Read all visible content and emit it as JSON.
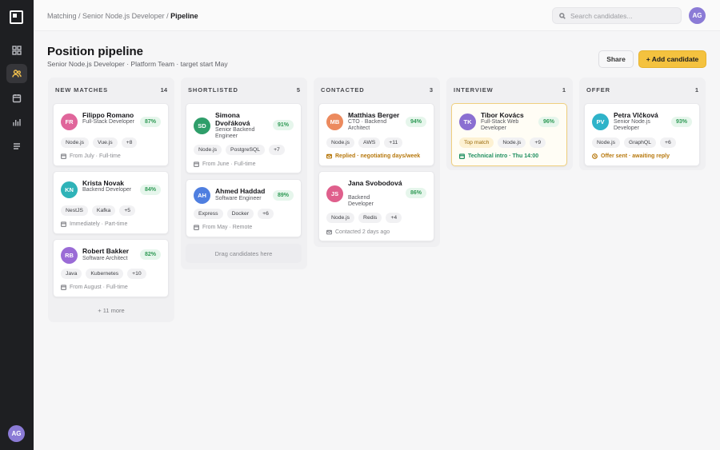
{
  "breadcrumb": {
    "part1": "Matching",
    "sep": " / ",
    "part2": "Senior Node.js Developer",
    "current": "Pipeline"
  },
  "search": {
    "placeholder": "Search candidates..."
  },
  "user": {
    "initials": "AG"
  },
  "page": {
    "title": "Position pipeline",
    "subtitle": "Senior Node.js Developer · Platform Team · target start May",
    "share_label": "Share",
    "add_label": "+ Add candidate"
  },
  "columns": [
    {
      "title": "NEW MATCHES",
      "count": "14",
      "more": "+ 11 more",
      "cards": [
        {
          "initials": "FR",
          "color": "#e0669b",
          "name": "Filippo Romano",
          "role": "Full-Stack Developer",
          "match": "87%",
          "tags": [
            "Node.js",
            "Vue.js",
            "+8"
          ],
          "foot": "From July · Full-time"
        },
        {
          "initials": "KN",
          "color": "#2fb3b8",
          "name": "Krista Novak",
          "role": "Backend Developer",
          "match": "84%",
          "tags": [
            "NestJS",
            "Kafka",
            "+5"
          ],
          "foot": "Immediately · Part-time"
        },
        {
          "initials": "RB",
          "color": "#9a6bd6",
          "name": "Robert Bakker",
          "role": "Software Architect",
          "match": "82%",
          "tags": [
            "Java",
            "Kubernetes",
            "+10"
          ],
          "foot": "From August · Full-time"
        }
      ]
    },
    {
      "title": "SHORTLISTED",
      "count": "5",
      "drop": "Drag candidates here",
      "cards": [
        {
          "initials": "SD",
          "color": "#2f9e6a",
          "name": "Simona Dvořáková",
          "role": "Senior Backend Engineer",
          "match": "91%",
          "tags": [
            "Node.js",
            "PostgreSQL",
            "+7"
          ],
          "foot": "From June · Full-time"
        },
        {
          "initials": "AH",
          "color": "#4f7fe0",
          "name": "Ahmed Haddad",
          "role": "Software Engineer",
          "match": "89%",
          "tags": [
            "Express",
            "Docker",
            "+6"
          ],
          "foot": "From May · Remote"
        }
      ]
    },
    {
      "title": "CONTACTED",
      "count": "3",
      "cards": [
        {
          "initials": "MB",
          "color": "#ec8a5e",
          "name": "Matthias Berger",
          "role": "CTO · Backend Architect",
          "match": "94%",
          "tags": [
            "Node.js",
            "AWS",
            "+11"
          ],
          "foot": "Replied · negotiating days/week"
        },
        {
          "initials": "JS",
          "color": "#df5f8c",
          "name": "Jana Svobodová",
          "role": "Backend Developer",
          "match": "86%",
          "tags": [
            "Node.js",
            "Redis",
            "+4"
          ],
          "foot": "Contacted 2 days ago"
        }
      ]
    },
    {
      "title": "INTERVIEW",
      "count": "1",
      "cards": [
        {
          "initials": "TK",
          "color": "#8a6fd1",
          "name": "Tibor Kovács",
          "role": "Full-Stack Web Developer",
          "match": "96%",
          "tags": [
            "Top match",
            "Node.js",
            "+9"
          ],
          "foot": "Technical intro · Thu 14:00"
        }
      ]
    },
    {
      "title": "OFFER",
      "count": "1",
      "cards": [
        {
          "initials": "PV",
          "color": "#2fb3c9",
          "name": "Petra Vlčková",
          "role": "Senior Node.js Developer",
          "match": "93%",
          "tags": [
            "Node.js",
            "GraphQL",
            "+6"
          ],
          "foot": "Offer sent · awaiting reply"
        }
      ]
    }
  ]
}
